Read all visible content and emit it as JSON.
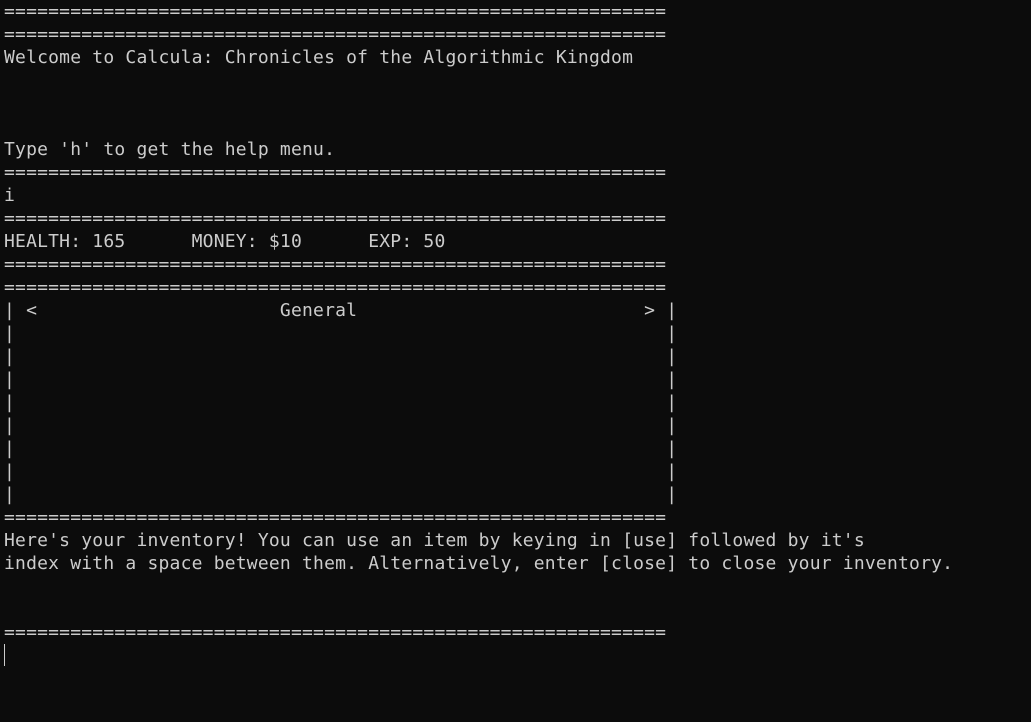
{
  "terminal": {
    "lines": [
      "============================================================",
      "============================================================",
      "Welcome to Calcula: Chronicles of the Algorithmic Kingdom",
      "",
      "",
      "",
      "Type 'h' to get the help menu.",
      "============================================================",
      "i",
      "============================================================",
      "HEALTH: 165      MONEY: $10      EXP: 50",
      "============================================================",
      "============================================================",
      "| <                      General                          > |",
      "|                                                           |",
      "|                                                           |",
      "|                                                           |",
      "|                                                           |",
      "|                                                           |",
      "|                                                           |",
      "|                                                           |",
      "|                                                           |",
      "============================================================",
      "Here's your inventory! You can use an item by keying in [use] followed by it's",
      "index with a space between them. Alternatively, enter [close] to close your inventory.",
      "",
      "",
      "============================================================",
      ""
    ]
  }
}
